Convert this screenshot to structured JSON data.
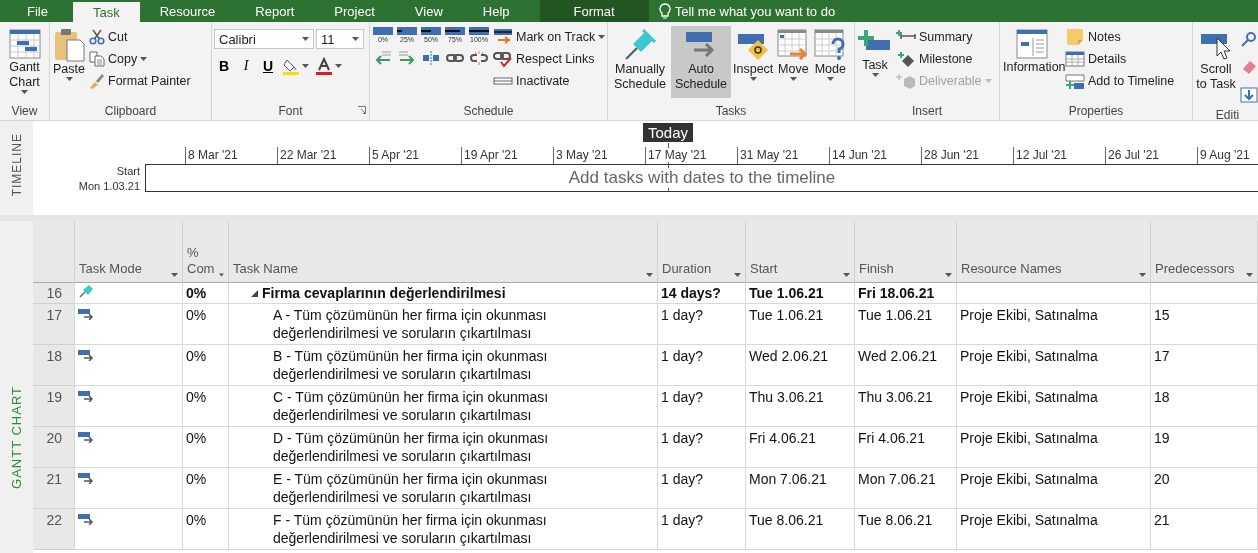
{
  "tabs": [
    {
      "label": "File",
      "kind": "file",
      "selected": false
    },
    {
      "label": "Task",
      "kind": "normal",
      "selected": true
    },
    {
      "label": "Resource",
      "kind": "normal",
      "selected": false
    },
    {
      "label": "Report",
      "kind": "normal",
      "selected": false
    },
    {
      "label": "Project",
      "kind": "normal",
      "selected": false
    },
    {
      "label": "View",
      "kind": "normal",
      "selected": false
    },
    {
      "label": "Help",
      "kind": "normal",
      "selected": false
    },
    {
      "label": "Format",
      "kind": "contextual",
      "selected": false
    }
  ],
  "tell_me": "Tell me what you want to do",
  "ribbon": {
    "groups": [
      {
        "label": "View",
        "columns": [
          [
            [
              {
                "kind": "large",
                "label": "Gantt Chart",
                "dropdown": true
              }
            ]
          ]
        ]
      },
      {
        "label": "Clipboard",
        "columns": [
          [
            [
              {
                "kind": "large",
                "label": "Paste",
                "dropdown": true
              }
            ]
          ],
          [
            [
              {
                "kind": "small",
                "label": "Cut"
              }
            ],
            [
              {
                "kind": "small",
                "label": "Copy",
                "dropdown": true
              }
            ],
            [
              {
                "kind": "small",
                "label": "Format Painter"
              }
            ]
          ]
        ]
      },
      {
        "label": "Font",
        "launcher": true,
        "columns": [
          [
            [
              {
                "kind": "combo",
                "value": "Calibri"
              },
              {
                "kind": "combo",
                "value": "11"
              }
            ],
            [
              {
                "kind": "glyph",
                "label": "B"
              },
              {
                "kind": "glyph",
                "label": "I"
              },
              {
                "kind": "glyph",
                "label": "U"
              },
              {
                "kind": "icon",
                "dropdown": true
              },
              {
                "kind": "icon",
                "dropdown": true
              }
            ]
          ]
        ]
      },
      {
        "label": "Schedule",
        "columns": [
          [
            [
              {
                "kind": "percent",
                "label": "0%"
              },
              {
                "kind": "percent",
                "label": "25%"
              },
              {
                "kind": "percent",
                "label": "50%"
              },
              {
                "kind": "percent",
                "label": "75%"
              },
              {
                "kind": "percent",
                "label": "100%"
              }
            ],
            [
              {
                "kind": "icon"
              },
              {
                "kind": "icon"
              },
              {
                "kind": "icon"
              },
              {
                "kind": "icon"
              },
              {
                "kind": "icon"
              }
            ]
          ],
          [
            [
              {
                "kind": "small",
                "label": "Mark on Track",
                "dropdown": true
              }
            ],
            [
              {
                "kind": "small",
                "label": "Respect Links"
              }
            ],
            [
              {
                "kind": "small",
                "label": "Inactivate"
              }
            ]
          ]
        ]
      },
      {
        "label": "Tasks",
        "columns": [
          [
            [
              {
                "kind": "large",
                "label": "Manually Schedule",
                "selected": false
              }
            ]
          ],
          [
            [
              {
                "kind": "large",
                "label": "Auto Schedule",
                "selected": true
              }
            ]
          ],
          [
            [
              {
                "kind": "large",
                "label": "Inspect",
                "dropdown": true
              }
            ]
          ],
          [
            [
              {
                "kind": "large",
                "label": "Move",
                "dropdown": true
              }
            ]
          ],
          [
            [
              {
                "kind": "large",
                "label": "Mode",
                "dropdown": true
              }
            ]
          ]
        ]
      },
      {
        "label": "Insert",
        "columns": [
          [
            [
              {
                "kind": "large",
                "label": "Task",
                "dropdown": true
              }
            ]
          ],
          [
            [
              {
                "kind": "small",
                "label": "Summary",
                "disabled": false
              }
            ],
            [
              {
                "kind": "small",
                "label": "Milestone",
                "disabled": false
              }
            ],
            [
              {
                "kind": "small",
                "label": "Deliverable",
                "dropdown": true,
                "disabled": true
              }
            ]
          ]
        ]
      },
      {
        "label": "Properties",
        "columns": [
          [
            [
              {
                "kind": "large",
                "label": "Information"
              }
            ]
          ],
          [
            [
              {
                "kind": "small",
                "label": "Notes"
              }
            ],
            [
              {
                "kind": "small",
                "label": "Details"
              }
            ],
            [
              {
                "kind": "small",
                "label": "Add to Timeline"
              }
            ]
          ]
        ]
      },
      {
        "label": "Editi",
        "columns": [
          [
            [
              {
                "kind": "large",
                "label": "Scroll to Task"
              }
            ]
          ],
          [
            [
              {
                "kind": "icon"
              }
            ],
            [
              {
                "kind": "icon"
              }
            ],
            [
              {
                "kind": "icon"
              }
            ]
          ]
        ]
      }
    ]
  },
  "timeline": {
    "label": "TIMELINE",
    "today": "Today",
    "start_label": "Start",
    "start_date": "Mon 1.03.21",
    "placeholder": "Add tasks with dates to the timeline",
    "dates": [
      "8 Mar '21",
      "22 Mar '21",
      "5 Apr '21",
      "19 Apr '21",
      "3 May '21",
      "17 May '21",
      "31 May '21",
      "14 Jun '21",
      "28 Jun '21",
      "12 Jul '21",
      "26 Jul '21",
      "9 Aug '21"
    ]
  },
  "gantt": {
    "label": "GANTT CHART",
    "columns": [
      "Task Mode",
      "% Com",
      "Task Name",
      "Duration",
      "Start",
      "Finish",
      "Resource Names",
      "Predecessors"
    ],
    "tasks": [
      {
        "id": "16",
        "kind": "manual",
        "complete": "0%",
        "name": "Firma cevaplarının değerlendirilmesi",
        "duration": "14 days?",
        "start": "Tue 1.06.21",
        "finish": "Fri 18.06.21",
        "expanded": true,
        "children": [
          {
            "id": "17",
            "kind": "auto",
            "complete": "0%",
            "name": "A - Tüm çözümünün her firma için okunması değerlendirilmesi ve soruların çıkartılması",
            "duration": "1 day?",
            "start": "Tue 1.06.21",
            "finish": "Tue 1.06.21",
            "resources": "Proje Ekibi, Satınalma",
            "predecessors": "15"
          },
          {
            "id": "18",
            "kind": "auto",
            "complete": "0%",
            "name": "B - Tüm çözümünün her firma için okunması değerlendirilmesi ve soruların çıkartılması",
            "duration": "1 day?",
            "start": "Wed 2.06.21",
            "finish": "Wed 2.06.21",
            "resources": "Proje Ekibi, Satınalma",
            "predecessors": "17"
          },
          {
            "id": "19",
            "kind": "auto",
            "complete": "0%",
            "name": "C - Tüm çözümünün her firma için okunması değerlendirilmesi ve soruların çıkartılması",
            "duration": "1 day?",
            "start": "Thu 3.06.21",
            "finish": "Thu 3.06.21",
            "resources": "Proje Ekibi, Satınalma",
            "predecessors": "18"
          },
          {
            "id": "20",
            "kind": "auto",
            "complete": "0%",
            "name": "D - Tüm çözümünün her firma için okunması değerlendirilmesi ve soruların çıkartılması",
            "duration": "1 day?",
            "start": "Fri 4.06.21",
            "finish": "Fri 4.06.21",
            "resources": "Proje Ekibi, Satınalma",
            "predecessors": "19"
          },
          {
            "id": "21",
            "kind": "auto",
            "complete": "0%",
            "name": "E - Tüm çözümünün her firma için okunması değerlendirilmesi ve soruların çıkartılması",
            "duration": "1 day?",
            "start": "Mon 7.06.21",
            "finish": "Mon 7.06.21",
            "resources": "Proje Ekibi, Satınalma",
            "predecessors": "20"
          },
          {
            "id": "22",
            "kind": "auto",
            "complete": "0%",
            "name": "F - Tüm çözümünün her firma için okunması değerlendirilmesi ve soruların çıkartılması",
            "duration": "1 day?",
            "start": "Tue 8.06.21",
            "finish": "Tue 8.06.21",
            "resources": "Proje Ekibi, Satınalma",
            "predecessors": "21"
          }
        ]
      }
    ]
  }
}
